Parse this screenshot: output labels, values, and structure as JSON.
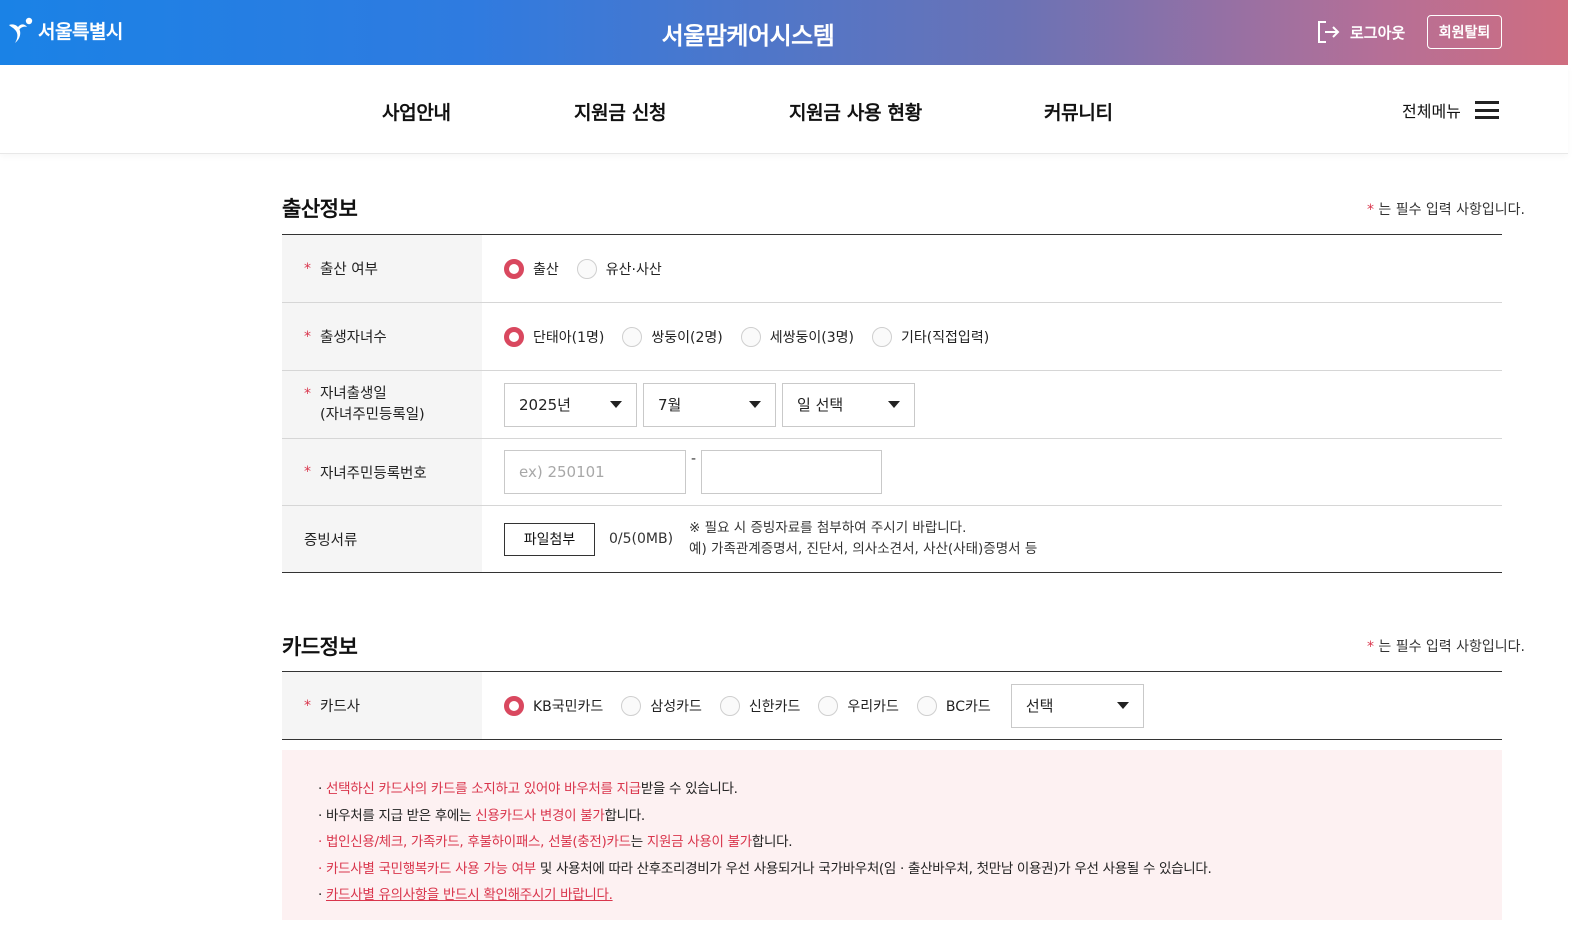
{
  "header": {
    "logo_text": "서울특별시",
    "system_title": "서울맘케어시스템",
    "logout_label": "로그아웃",
    "withdraw_label": "회원탈퇴"
  },
  "nav": {
    "items": [
      "사업안내",
      "지원금 신청",
      "지원금 사용 현황",
      "커뮤니티"
    ],
    "all_menu_label": "전체메뉴"
  },
  "birth_section": {
    "title": "출산정보",
    "required_note": "는 필수 입력 사항입니다.",
    "birth_status": {
      "label": "출산 여부",
      "options": [
        {
          "label": "출산",
          "checked": true
        },
        {
          "label": "유산·사산",
          "checked": false
        }
      ]
    },
    "child_count": {
      "label": "출생자녀수",
      "options": [
        {
          "label": "단태아(1명)",
          "checked": true
        },
        {
          "label": "쌍둥이(2명)",
          "checked": false
        },
        {
          "label": "세쌍둥이(3명)",
          "checked": false
        },
        {
          "label": "기타(직접입력)",
          "checked": false
        }
      ]
    },
    "birth_date": {
      "label_line1": "자녀출생일",
      "label_line2": "(자녀주민등록일)",
      "year": "2025년",
      "month": "7월",
      "day": "일 선택"
    },
    "resident_no": {
      "label": "자녀주민등록번호",
      "front_placeholder": "ex) 250101",
      "front_value": "",
      "back_value": "",
      "separator": "-"
    },
    "documents": {
      "label": "증빙서류",
      "button_label": "파일첨부",
      "count": "0/5(0MB)",
      "note_line1": "※ 필요 시 증빙자료를 첨부하여 주시기 바랍니다.",
      "note_line2": "예) 가족관계증명서, 진단서, 의사소견서, 사산(사태)증명서 등"
    }
  },
  "card_section": {
    "title": "카드정보",
    "required_note": "는 필수 입력 사항입니다.",
    "card_company": {
      "label": "카드사",
      "options": [
        {
          "label": "KB국민카드",
          "checked": true
        },
        {
          "label": "삼성카드",
          "checked": false
        },
        {
          "label": "신한카드",
          "checked": false
        },
        {
          "label": "우리카드",
          "checked": false
        },
        {
          "label": "BC카드",
          "checked": false
        }
      ],
      "select_value": "선택"
    }
  },
  "notice": {
    "line1_a": "· ",
    "line1_hl": "선택하신 카드사의 카드를 소지하고 있어야 바우처를 지급",
    "line1_b": "받을 수 있습니다.",
    "line2_a": "· 바우처를 지급 받은 후에는 ",
    "line2_hl": "신용카드사 변경이 불가",
    "line2_b": "합니다.",
    "line3_hl1": "· 법인신용/체크, 가족카드, 후불하이패스, 선불(충전)카드",
    "line3_a": "는 ",
    "line3_hl2": "지원금 사용이 불가",
    "line3_b": "합니다.",
    "line4_hl": "· 카드사별 국민행복카드 사용 가능 여부",
    "line4_b": " 및 사용처에 따라 산후조리경비가 우선 사용되거나 국가바우처(임 · 출산바우처, 첫만남 이용권)가 우선 사용될 수 있습니다.",
    "line5_a": "· ",
    "line5_hl": "카드사별 유의사항을 반드시 확인해주시기 바랍니다."
  },
  "colors": {
    "accent": "#d9485f",
    "header_start": "#1a82e6",
    "header_end": "#cf6e80",
    "notice_bg": "#fdf1f2"
  }
}
